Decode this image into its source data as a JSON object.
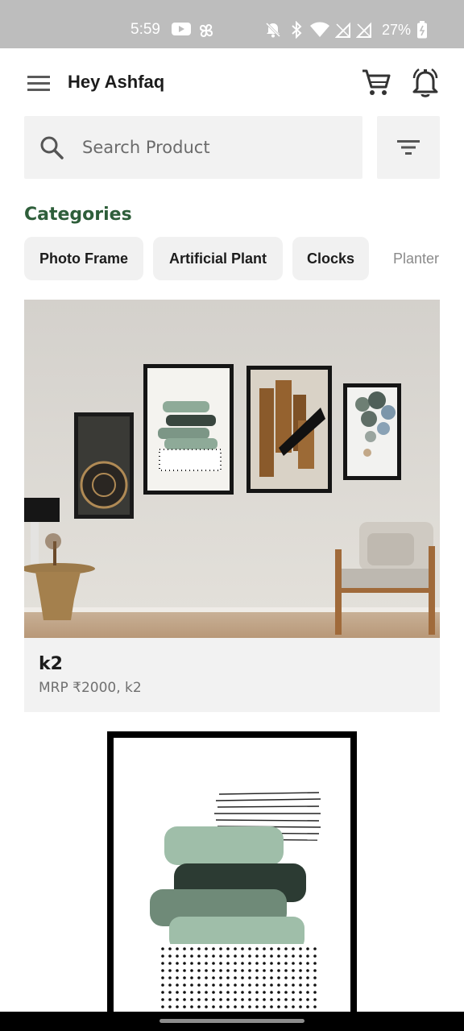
{
  "status_bar": {
    "time": "5:59",
    "battery": "27%",
    "icons": [
      "youtube-icon",
      "pinwheel-icon",
      "mute-icon",
      "bluetooth-icon",
      "wifi-icon",
      "no-signal-icon",
      "no-signal-icon",
      "battery-icon"
    ]
  },
  "app_bar": {
    "greeting": "Hey Ashfaq",
    "icons": [
      "menu-icon",
      "cart-icon",
      "bell-icon"
    ]
  },
  "search": {
    "placeholder": "Search Product",
    "value": ""
  },
  "categories": {
    "title": "Categories",
    "items": [
      {
        "label": "Photo Frame"
      },
      {
        "label": "Artificial Plant"
      },
      {
        "label": "Clocks"
      },
      {
        "label": "Planter"
      }
    ]
  },
  "products": [
    {
      "title": "k2",
      "subtitle": "MRP ₹2000, k2"
    }
  ],
  "colors": {
    "accent_green": "#2e5e3a",
    "surface": "#f2f2f2",
    "status_bar": "#bdbdbd"
  }
}
